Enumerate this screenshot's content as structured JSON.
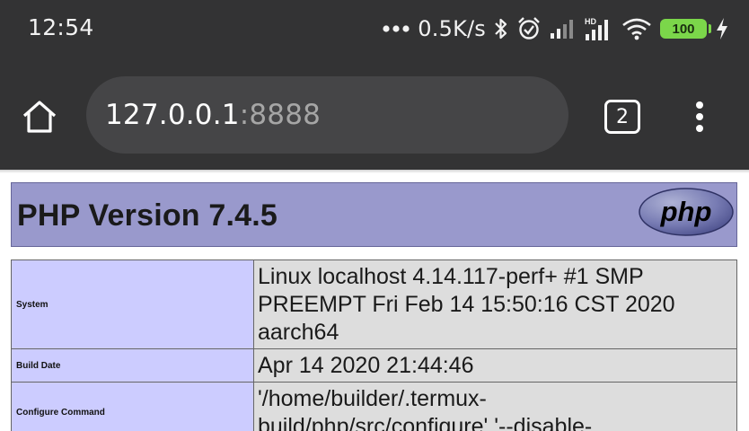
{
  "status_bar": {
    "time": "12:54",
    "net_speed": "0.5K/s",
    "battery": "100",
    "hd_label": "HD",
    "icons": [
      "dots-icon",
      "bluetooth-icon",
      "alarm-icon",
      "signal-icon",
      "hd-signal-icon",
      "wifi-icon",
      "battery-icon",
      "charging-icon"
    ]
  },
  "browser": {
    "url_host": "127.0.0.1",
    "url_port": ":8888",
    "tab_count": "2",
    "icons": [
      "home-icon",
      "tabs-icon",
      "more-vert-icon"
    ]
  },
  "page": {
    "title": "PHP Version 7.4.5",
    "logo_text": "php",
    "rows": [
      {
        "key": "System",
        "lines": [
          "Linux localhost 4.14.117-perf+ #1 SMP",
          "PREEMPT Fri Feb 14 15:50:16 CST 2020",
          "aarch64"
        ]
      },
      {
        "key": "Build Date",
        "lines": [
          "Apr 14 2020 21:44:46"
        ]
      },
      {
        "key": "Configure Command",
        "lines": [
          "'/home/builder/.termux-",
          "build/php/src/configure' '--disable-"
        ]
      }
    ]
  },
  "colors": {
    "chrome_bg": "#333334",
    "url_bg": "#454547",
    "php_header": "#9999cc",
    "key_cell": "#ccccff",
    "value_cell": "#dddddd",
    "battery": "#7bd64a"
  }
}
